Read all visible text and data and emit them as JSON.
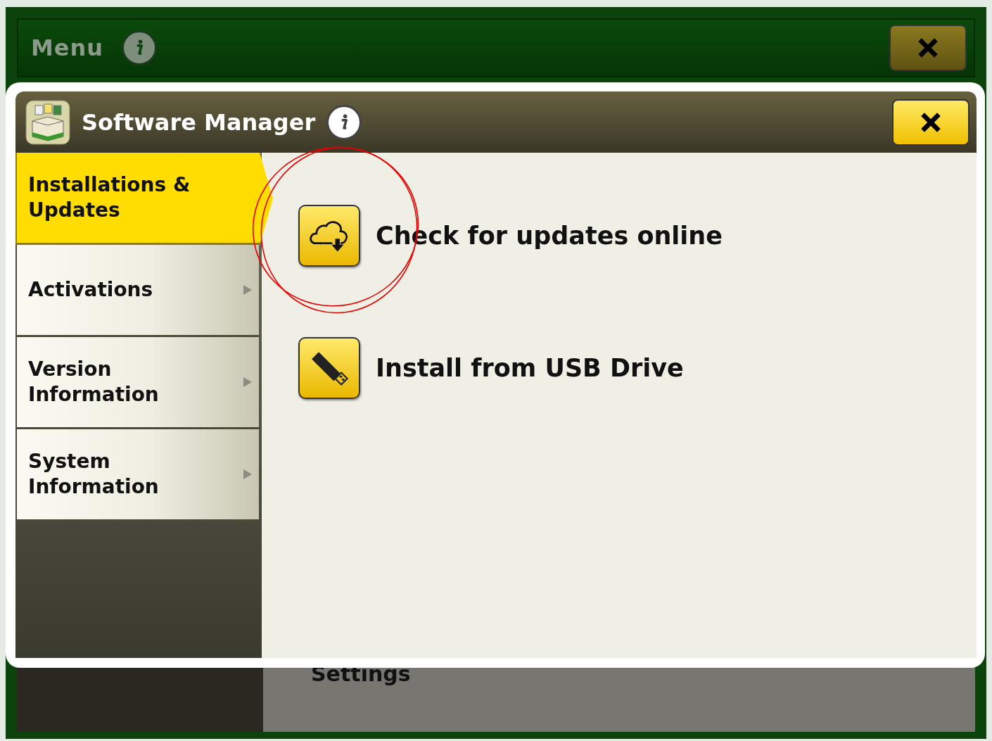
{
  "background_screen": {
    "title": "Menu",
    "settings_label": "Settings"
  },
  "dialog": {
    "title": "Software Manager"
  },
  "nav_items": [
    {
      "label": "Installations & Updates",
      "selected": true
    },
    {
      "label": "Activations",
      "selected": false
    },
    {
      "label": "Version Information",
      "selected": false
    },
    {
      "label": "System Information",
      "selected": false
    }
  ],
  "options": [
    {
      "kind": "cloud",
      "label": "Check for updates online"
    },
    {
      "kind": "usb",
      "label": "Install from USB Drive"
    }
  ]
}
